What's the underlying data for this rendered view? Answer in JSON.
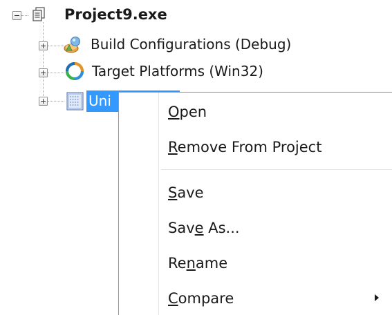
{
  "tree": {
    "root": {
      "label": "Project9.exe",
      "icon": "project-file-icon",
      "expander": "minus"
    },
    "children": [
      {
        "label": "Build Configurations (Debug)",
        "icon": "build-config-icon",
        "expander": "plus"
      },
      {
        "label": "Target Platforms (Win32)",
        "icon": "target-platforms-icon",
        "expander": "plus"
      },
      {
        "label": "Uni",
        "icon": "unit-file-icon",
        "expander": "plus",
        "selected": true
      }
    ]
  },
  "context_menu": {
    "items": [
      {
        "pre": "",
        "key": "O",
        "post": "pen"
      },
      {
        "pre": "",
        "key": "R",
        "post": "emove From Project"
      },
      {
        "pre": "",
        "key": "S",
        "post": "ave"
      },
      {
        "pre": "Sav",
        "key": "e",
        "post": " As..."
      },
      {
        "pre": "Re",
        "key": "n",
        "post": "ame"
      },
      {
        "pre": "",
        "key": "C",
        "post": "ompare",
        "submenu": true
      }
    ]
  },
  "colors": {
    "selection": "#3399ff",
    "menu_border": "#979797",
    "separator": "#e2e3e3"
  }
}
